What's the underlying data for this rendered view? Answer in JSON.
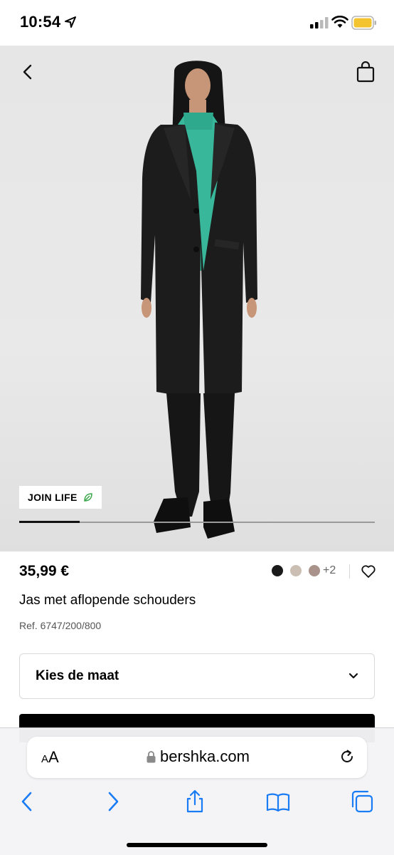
{
  "status_bar": {
    "time": "10:54"
  },
  "product": {
    "badge": "JOIN LIFE",
    "image_position": 0.17,
    "price": "35,99 €",
    "colors": [
      "#1a1a1a",
      "#cbbfb3",
      "#a9928a"
    ],
    "more_colors": "+2",
    "name": "Jas met aflopende schouders",
    "ref": "Ref. 6747/200/800",
    "size_placeholder": "Kies de maat"
  },
  "browser": {
    "text_size_label_small": "A",
    "text_size_label_large": "A",
    "url": "bershka.com"
  },
  "icons": {
    "back": "chevron-left-icon",
    "bag": "shopping-bag-icon",
    "leaf": "leaf-icon",
    "favorite": "heart-icon",
    "dropdown": "chevron-down-icon",
    "lock": "lock-icon",
    "reload": "reload-icon",
    "browser_back": "chevron-left-icon",
    "browser_forward": "chevron-right-icon",
    "share": "share-icon",
    "bookmarks": "book-icon",
    "tabs": "tabs-icon"
  }
}
